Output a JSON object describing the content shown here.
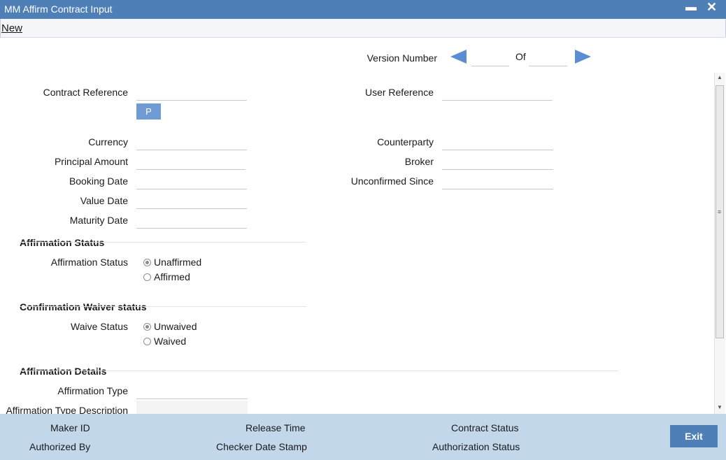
{
  "window": {
    "title": "MM Affirm Contract Input",
    "minimize_glyph": "▬",
    "close_glyph": "✕"
  },
  "menu": {
    "new_label": "New"
  },
  "version": {
    "label": "Version Number",
    "of_label": "Of",
    "current": "",
    "total": ""
  },
  "contract": {
    "contract_reference_label": "Contract Reference",
    "contract_reference_value": "",
    "p_button": "P",
    "user_reference_label": "User Reference",
    "user_reference_value": "",
    "currency_label": "Currency",
    "principal_amount_label": "Principal Amount",
    "booking_date_label": "Booking Date",
    "value_date_label": "Value Date",
    "maturity_date_label": "Maturity Date",
    "counterparty_label": "Counterparty",
    "broker_label": "Broker",
    "unconfirmed_since_label": "Unconfirmed Since"
  },
  "affirmation_status": {
    "section_title": "Affirmation Status",
    "field_label": "Affirmation Status",
    "options": [
      "Unaffirmed",
      "Affirmed"
    ],
    "selected": "Unaffirmed"
  },
  "waiver_status": {
    "section_title": "Confirmation Waiver status",
    "field_label": "Waive Status",
    "options": [
      "Unwaived",
      "Waived"
    ],
    "selected": "Unwaived"
  },
  "affirmation_details": {
    "section_title": "Affirmation Details",
    "type_label": "Affirmation Type",
    "type_description_label": "Affirmation Type Description"
  },
  "footer": {
    "maker_id": "Maker ID",
    "release_time": "Release Time",
    "contract_status": "Contract Status",
    "authorized_by": "Authorized By",
    "checker_date_stamp": "Checker Date Stamp",
    "authorization_status": "Authorization Status",
    "exit_label": "Exit"
  },
  "colors": {
    "titlebar": "#4f7fb7",
    "footer": "#c3d7eb",
    "accent_button": "#6f9ad3",
    "nav_arrow": "#5b8ed1"
  }
}
